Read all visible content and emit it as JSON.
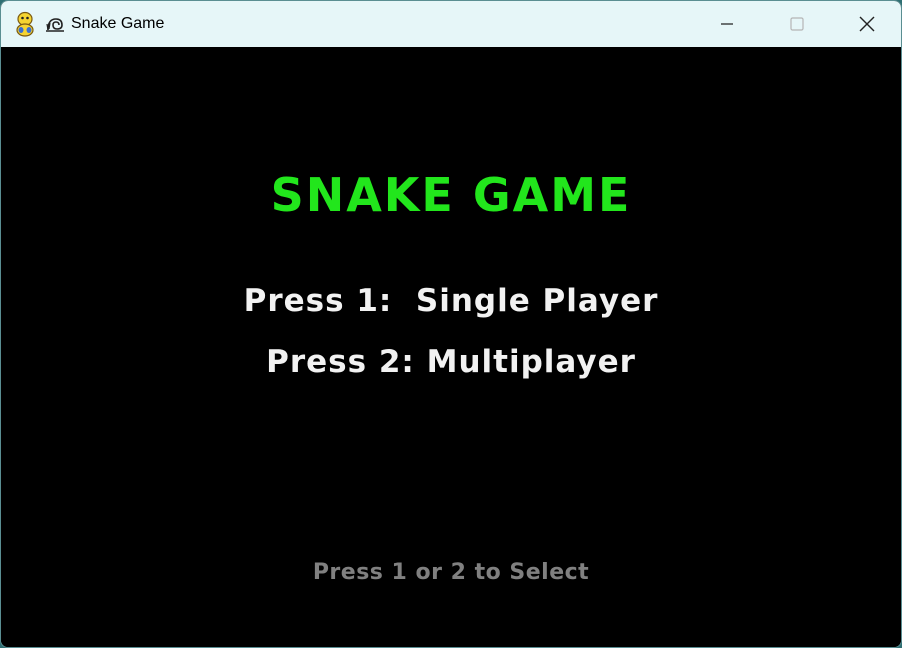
{
  "window": {
    "title": "Snake Game",
    "app_icon": "pygame-snake-icon",
    "title_icon": "snail-icon",
    "minimize_icon": "minimize-icon",
    "maximize_icon": "maximize-icon",
    "close_icon": "close-icon"
  },
  "menu": {
    "title": "SNAKE GAME",
    "option_single": "Press 1:  Single Player",
    "option_multi": "Press 2: Multiplayer",
    "hint": "Press 1 or 2 to Select"
  },
  "colors": {
    "background": "#000000",
    "title": "#22e61c",
    "option": "#f2f2f2",
    "hint": "#808080",
    "titlebar": "#e6f6f8"
  }
}
